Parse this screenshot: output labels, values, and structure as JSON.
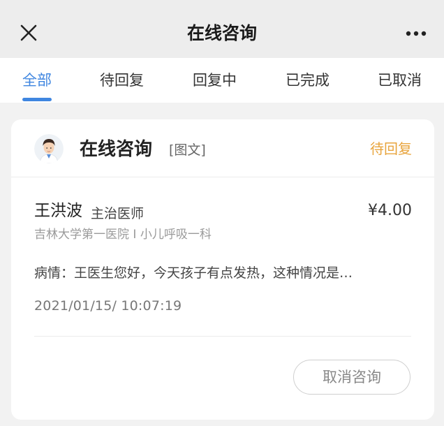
{
  "header": {
    "title": "在线咨询",
    "close_icon": "close-icon",
    "more_icon": "more-icon"
  },
  "tabs": [
    {
      "label": "全部",
      "active": true
    },
    {
      "label": "待回复",
      "active": false
    },
    {
      "label": "回复中",
      "active": false
    },
    {
      "label": "已完成",
      "active": false
    },
    {
      "label": "已取消",
      "active": false
    }
  ],
  "consultation": {
    "title": "在线咨询",
    "type": "[图文]",
    "status": "待回复",
    "doctor_name": "王洪波",
    "doctor_title": "主治医师",
    "price": "¥4.00",
    "hospital": "吉林大学第一医院 I 小儿呼吸一科",
    "symptom_label": "病情：",
    "symptom_text": "王医生您好，今天孩子有点发热，这种情况是…",
    "timestamp": "2021/01/15/ 10:07:19",
    "cancel_label": "取消咨询"
  },
  "colors": {
    "accent": "#3f86e0",
    "status": "#e8a43c",
    "background": "#f2f2f2",
    "topbar": "#ededed"
  }
}
